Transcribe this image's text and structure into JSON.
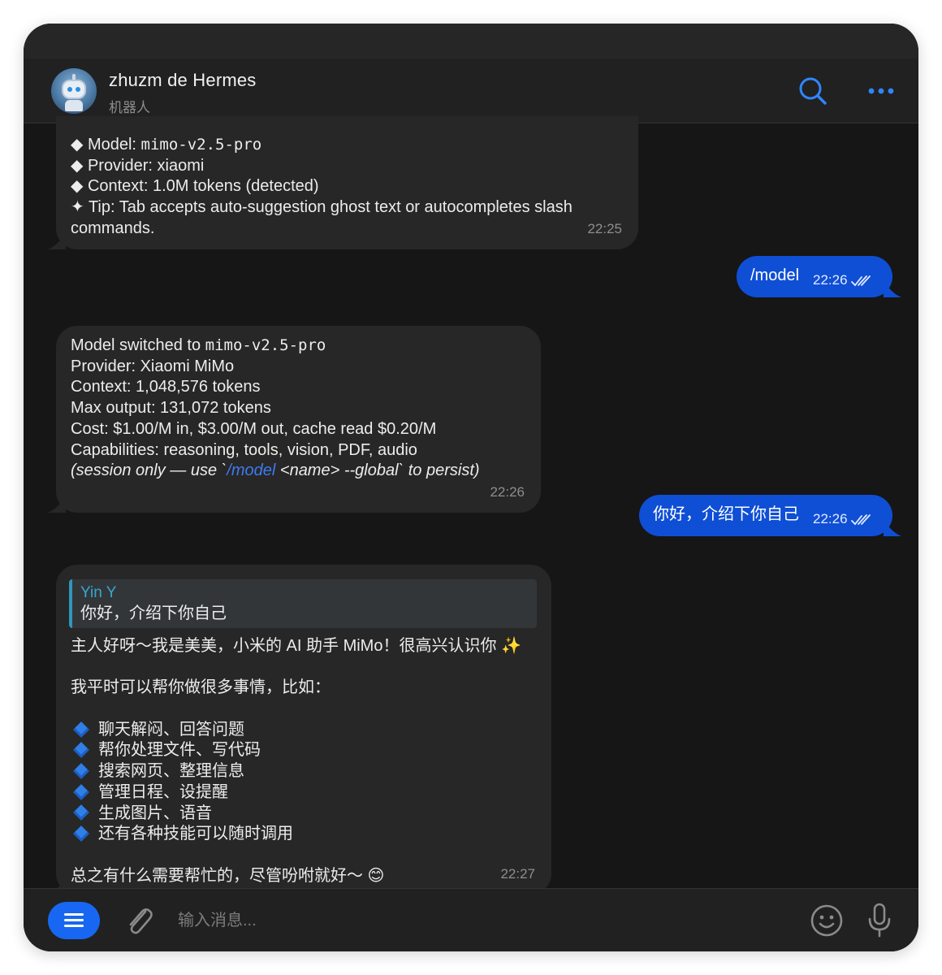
{
  "header": {
    "chat_name": "zhuzm de Hermes",
    "chat_subtitle": "机器人",
    "icons": {
      "avatar": "robot-avatar",
      "search": "search-icon",
      "more": "more-dots-icon"
    }
  },
  "messages": {
    "m1": {
      "lines": [
        "◆ Model: ",
        "◆ Provider: xiaomi",
        "◆ Context: 1.0M tokens (detected)",
        "✦ Tip: Tab accepts auto-suggestion ghost text or autocompletes slash",
        "commands."
      ],
      "model_code": "mimo-v2.5-pro",
      "time": "22:25"
    },
    "m2": {
      "text": "/model",
      "time": "22:26"
    },
    "m3": {
      "line1_prefix": "Model switched to ",
      "line1_code": "mimo-v2.5-pro",
      "lines": [
        "Provider: Xiaomi MiMo",
        "Context: 1,048,576 tokens",
        "Max output: 131,072 tokens",
        "Cost: $1.00/M in, $3.00/M out, cache read $0.20/M",
        "Capabilities: reasoning, tools, vision, PDF, audio"
      ],
      "note_prefix": "(session only — use `",
      "note_link": "/model",
      "note_suffix": " <name> --global` to persist)",
      "time": "22:26"
    },
    "m4": {
      "text": "你好，介绍下你自己",
      "time": "22:26"
    },
    "m5": {
      "quote_author": "Yin Y",
      "quote_text": "你好，介绍下你自己",
      "intro": "主人好呀～我是美美，小米的 AI 助手 MiMo！很高兴认识你 ✨",
      "lead": "我平时可以帮你做很多事情，比如：",
      "items": [
        "聊天解闷、回答问题",
        "帮你处理文件、写代码",
        "搜索网页、整理信息",
        "管理日程、设提醒",
        "生成图片、语音",
        "还有各种技能可以随时调用"
      ],
      "outro": "总之有什么需要帮忙的，尽管吩咐就好～ 😊",
      "time": "22:27"
    }
  },
  "composer": {
    "placeholder": "输入消息...",
    "icons": {
      "menu": "menu-icon",
      "attach": "paperclip-icon",
      "emoji": "smiley-icon",
      "mic": "microphone-icon"
    }
  },
  "colors": {
    "accent": "#1767f2",
    "outgoing_bubble": "#0f4fd6",
    "incoming_bubble": "#272727",
    "background": "#161616",
    "quote_bar": "#2e96bd"
  }
}
